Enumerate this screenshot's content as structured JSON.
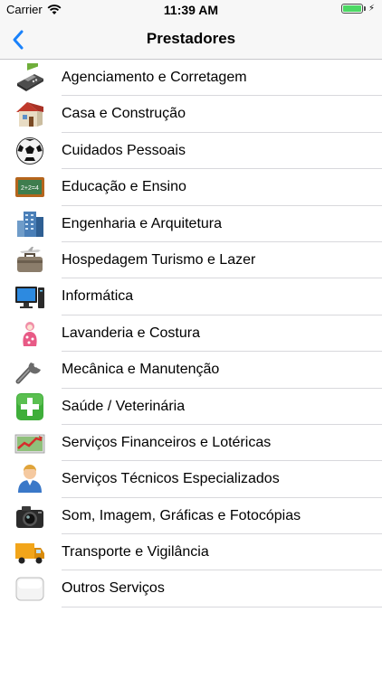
{
  "status": {
    "carrier": "Carrier",
    "time": "11:39 AM"
  },
  "nav": {
    "title": "Prestadores",
    "back_icon": "chevron-left-icon"
  },
  "categories": [
    {
      "label": "Agenciamento e Corretagem",
      "icon": "card-machine-icon"
    },
    {
      "label": "Casa e Construção",
      "icon": "house-icon"
    },
    {
      "label": "Cuidados Pessoais",
      "icon": "soccer-ball-icon"
    },
    {
      "label": "Educação e Ensino",
      "icon": "chalkboard-icon"
    },
    {
      "label": "Engenharia e Arquitetura",
      "icon": "building-icon"
    },
    {
      "label": "Hospedagem Turismo e Lazer",
      "icon": "suitcase-plane-icon"
    },
    {
      "label": "Informática",
      "icon": "computer-icon"
    },
    {
      "label": "Lavanderia e Costura",
      "icon": "doll-icon"
    },
    {
      "label": "Mecânica e Manutenção",
      "icon": "wrench-icon"
    },
    {
      "label": "Saúde / Veterinária",
      "icon": "health-cross-icon"
    },
    {
      "label": "Serviços Financeiros e Lotéricas",
      "icon": "finance-chart-icon"
    },
    {
      "label": "Serviços Técnicos Especializados",
      "icon": "person-icon"
    },
    {
      "label": "Som, Imagem, Gráficas e Fotocópias",
      "icon": "camera-icon"
    },
    {
      "label": "Transporte e Vigilância",
      "icon": "truck-icon"
    },
    {
      "label": "Outros Serviços",
      "icon": "blank-box-icon"
    }
  ]
}
